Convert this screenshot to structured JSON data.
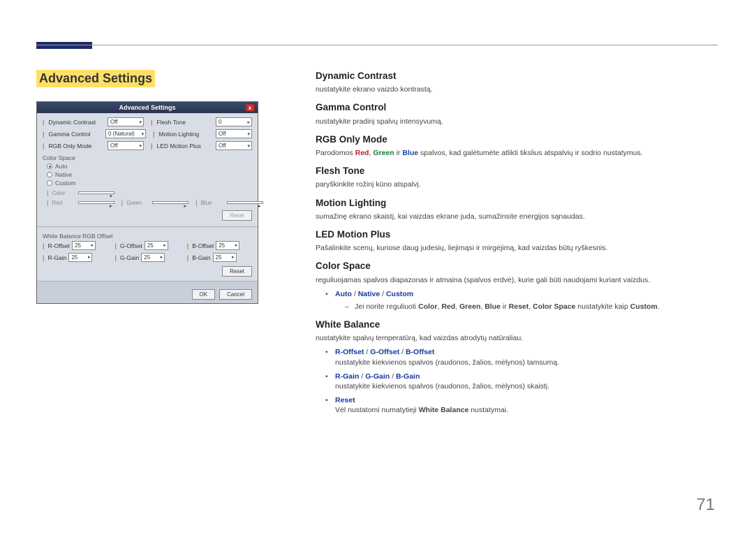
{
  "page_number": "71",
  "section_title": "Advanced Settings",
  "dialog": {
    "title": "Advanced Settings",
    "close": "x",
    "rows1": {
      "dyn_label": "Dynamic Contrast",
      "dyn_val": "Off",
      "flesh_label": "Flesh Tone",
      "flesh_val": "0",
      "gamma_label": "Gamma Control",
      "gamma_val": "0 (Natural)",
      "motion_label": "Motion Lighting",
      "motion_val": "Off",
      "rgb_label": "RGB Only Mode",
      "rgb_val": "Off",
      "led_label": "LED Motion Plus",
      "led_val": "Off"
    },
    "cs_label": "Color Space",
    "cs_options": {
      "auto": "Auto",
      "native": "Native",
      "custom": "Custom"
    },
    "color_row": {
      "color_lbl": "Color",
      "red_lbl": "Red",
      "green_lbl": "Green",
      "blue_lbl": "Blue"
    },
    "reset": "Reset",
    "wb_label": "White Balance RGB Offset",
    "wb": {
      "ro_lbl": "R-Offset",
      "ro_val": "25",
      "go_lbl": "G-Offset",
      "go_val": "25",
      "bo_lbl": "B-Offset",
      "bo_val": "25",
      "rg_lbl": "R-Gain",
      "rg_val": "25",
      "gg_lbl": "G-Gain",
      "gg_val": "25",
      "bg_lbl": "B-Gain",
      "bg_val": "25"
    },
    "ok": "OK",
    "cancel": "Cancel"
  },
  "content": {
    "dc_h": "Dynamic Contrast",
    "dc_p": "nustatykite ekrano vaizdo kontrastą.",
    "gc_h": "Gamma Control",
    "gc_p": "nustatykite pradinį spalvų intensyvumą.",
    "rgb_h": "RGB Only Mode",
    "rgb_prefix": "Parodomos ",
    "rgb_red": "Red",
    "rgb_sep1": ", ",
    "rgb_green": "Green",
    "rgb_sep2": " ir ",
    "rgb_blue": "Blue",
    "rgb_suffix": " spalvos, kad galėtumėte atlikti tikslius atspalvių ir sodrio nustatymus.",
    "ft_h": "Flesh Tone",
    "ft_p": "paryškinkite rožinį kūno atspalvį.",
    "ml_h": "Motion Lighting",
    "ml_p": "sumažinę ekrano skaistį, kai vaizdas ekrane juda, sumažinsite energijos sąnaudas.",
    "lmp_h": "LED Motion Plus",
    "lmp_p": "Pašalinkite scenų, kuriose daug judesių, liejimąsi ir mirgėjimą, kad vaizdas būtų ryškesnis.",
    "cs_h": "Color Space",
    "cs_p": "reguliuojamas spalvos diapazonas ir atmaina (spalvos erdvė), kurie gali būti naudojami kuriant vaizdus.",
    "cs_opt_auto": "Auto",
    "cs_opt_native": "Native",
    "cs_opt_custom": "Custom",
    "cs_sub_prefix": "Jei norite reguliuoti ",
    "cs_sub_color": "Color",
    "cs_sub_s1": ", ",
    "cs_sub_red": "Red",
    "cs_sub_s2": ", ",
    "cs_sub_green": "Green",
    "cs_sub_s3": ", ",
    "cs_sub_blue": "Blue",
    "cs_sub_s4": " ir ",
    "cs_sub_reset": "Reset",
    "cs_sub_s5": ", ",
    "cs_sub_cspace": "Color Space",
    "cs_sub_s6": " nustatykite kaip ",
    "cs_sub_custom2": "Custom",
    "cs_sub_s7": ".",
    "wb_h": "White Balance",
    "wb_p": "nustatykite spalvų temperatūrą, kad vaizdas atrodytų natūraliau.",
    "wb_off_ro": "R-Offset",
    "wb_off_go": "G-Offset",
    "wb_off_bo": "B-Offset",
    "wb_off_desc": "nustatykite kiekvienos spalvos (raudonos, žalios, mėlynos) tamsumą.",
    "wb_gain_rg": "R-Gain",
    "wb_gain_gg": "G-Gain",
    "wb_gain_bg": "B-Gain",
    "wb_gain_desc": "nustatykite kiekvienos spalvos (raudonos, žalios, mėlynos) skaistį.",
    "wb_reset": "Reset",
    "wb_reset_prefix": "Vėl nustatomi numatytieji ",
    "wb_reset_wb": "White Balance",
    "wb_reset_suffix": " nustatymai.",
    "slash": " / "
  }
}
